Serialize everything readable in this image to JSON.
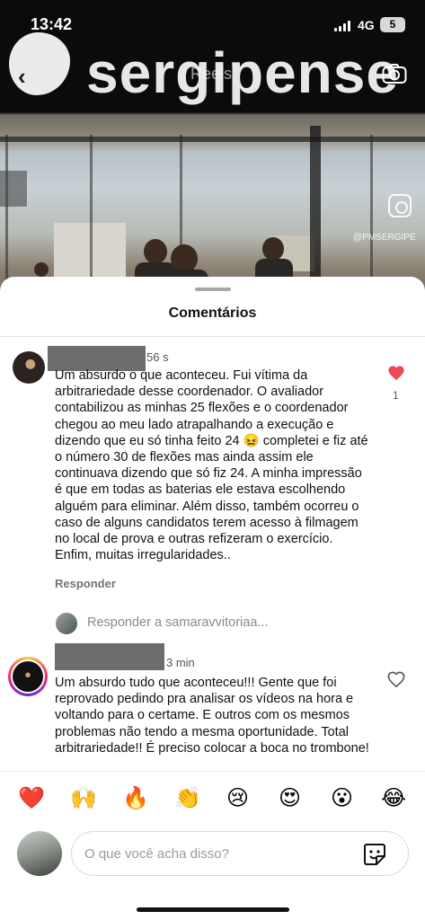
{
  "status_bar": {
    "time": "13:42",
    "network": "4G",
    "battery": "5"
  },
  "video": {
    "watermark": "sergipense",
    "title": "Reels",
    "handle": "@PMSERGIPE",
    "icons": [
      "back-icon",
      "camera-icon",
      "instagram-icon"
    ]
  },
  "sheet": {
    "title": "Comentários"
  },
  "comments": [
    {
      "time": "56 s",
      "text": "Um absurdo o que aconteceu. Fui vítima da arbitrariedade desse coordenador. O avaliador contabilizou as minhas 25 flexões e o coordenador chegou ao meu lado atrapalhando a execução e dizendo que eu só tinha feito 24 😖 completei e fiz até o número 30 de flexões mas ainda assim ele continuava dizendo que só fiz 24. A minha impressão é que em todas as baterias ele estava escolhendo alguém para eliminar. Além disso, também ocorreu o caso de alguns candidatos terem acesso à filmagem no local de prova e outras refizeram o exercício. Enfim, muitas irregularidades..",
      "reply_label": "Responder",
      "likes": "1",
      "liked": true
    },
    {
      "time": "3 min",
      "text": "Um absurdo tudo que aconteceu!!! Gente que foi reprovado pedindo pra analisar os vídeos na hora e voltando para o certame. E outros com os mesmos problemas não tendo a mesma oportunidade. Total arbitrariedade!! É preciso colocar a boca no trombone!",
      "liked": false
    }
  ],
  "reply_to": "Responder a samaravvitoriaa...",
  "emojis": [
    "❤️",
    "🙌",
    "🔥",
    "👏",
    "😢",
    "😍",
    "😮",
    "😂"
  ],
  "composer": {
    "placeholder": "O que você acha disso?",
    "value": ""
  },
  "colors": {
    "like_red": "#ed4956",
    "text": "#111111",
    "muted": "#737373"
  }
}
